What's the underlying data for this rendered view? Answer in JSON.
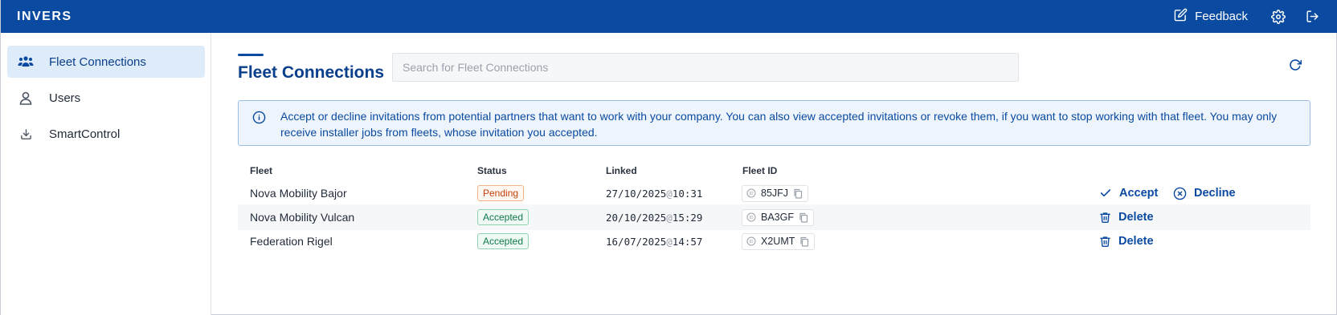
{
  "topbar": {
    "logo": "INVERS",
    "feedback_label": "Feedback",
    "icons": [
      "edit-icon",
      "gear-icon",
      "logout-icon"
    ]
  },
  "sidebar": {
    "items": [
      {
        "label": "Fleet Connections",
        "icon": "users-group-icon",
        "active": true
      },
      {
        "label": "Users",
        "icon": "user-icon",
        "active": false
      },
      {
        "label": "SmartControl",
        "icon": "download-icon",
        "active": false
      }
    ]
  },
  "main": {
    "title": "Fleet Connections",
    "search_placeholder": "Search for Fleet Connections",
    "info_text": "Accept or decline invitations from potential partners that want to work with your company. You can also view accepted invitations or revoke them, if you want to stop working with that fleet. You may only receive installer jobs from fleets, whose invitation you accepted.",
    "table": {
      "columns": [
        "Fleet",
        "Status",
        "Linked",
        "Fleet ID"
      ],
      "rows": [
        {
          "fleet": "Nova Mobility Bajor",
          "status": "Pending",
          "date": "27/10/2025",
          "time": "10:31",
          "fleet_id": "85JFJ",
          "actions": [
            "Accept",
            "Decline"
          ]
        },
        {
          "fleet": "Nova Mobility Vulcan",
          "status": "Accepted",
          "date": "20/10/2025",
          "time": "15:29",
          "fleet_id": "BA3GF",
          "actions": [
            "Delete"
          ]
        },
        {
          "fleet": "Federation Rigel",
          "status": "Accepted",
          "date": "16/07/2025",
          "time": "14:57",
          "fleet_id": "X2UMT",
          "actions": [
            "Delete"
          ]
        }
      ]
    }
  },
  "colors": {
    "brand": "#0a4aa1",
    "pending": "#c2410c",
    "accepted": "#0f7a4a"
  }
}
